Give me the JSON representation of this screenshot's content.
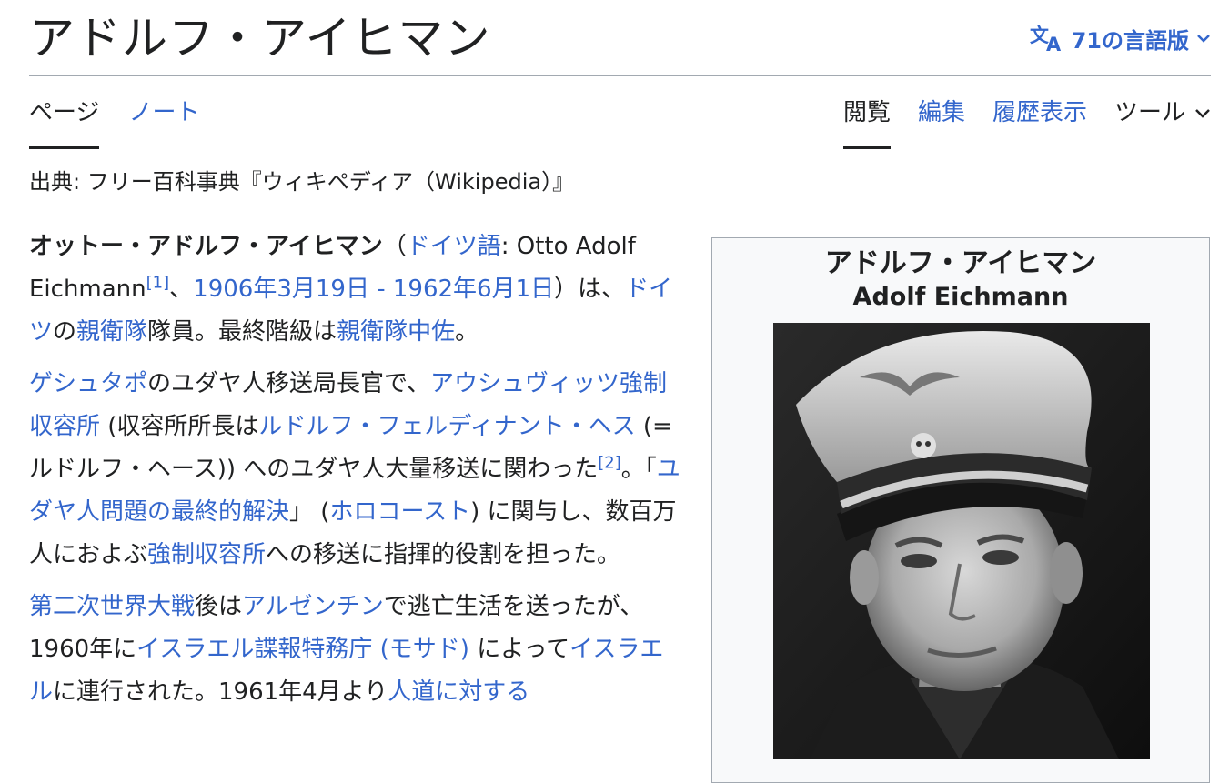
{
  "page": {
    "title": "アドルフ・アイヒマン",
    "languages_label": "71の言語版",
    "site_sub": "出典: フリー百科事典『ウィキペディア（Wikipedia）』"
  },
  "tabs": {
    "left": [
      {
        "label": "ページ",
        "selected": true
      },
      {
        "label": "ノート",
        "selected": false
      }
    ],
    "right": [
      {
        "label": "閲覧",
        "selected": true
      },
      {
        "label": "編集",
        "selected": false
      },
      {
        "label": "履歴表示",
        "selected": false
      },
      {
        "label": "ツール",
        "selected": false
      }
    ]
  },
  "article": {
    "p1": {
      "bold_name": "オットー・アドルフ・アイヒマン",
      "paren_open": "（",
      "lang_link": "ドイツ語",
      "lang_text": ": Otto Adolf Eichmann",
      "ref1": "[1]",
      "sep1": "、",
      "birth_link": "1906年3月19日",
      "dash": " - ",
      "death_link": "1962年6月1日",
      "after_dates": "）は、",
      "germany_link": "ドイツ",
      "no": "の",
      "ss_link": "親衛隊",
      "member": "隊員。最終階級は",
      "rank_link": "親衛隊中佐",
      "end": "。"
    },
    "p2": {
      "gestapo_link": "ゲシュタポ",
      "t1": "のユダヤ人移送局長官で、",
      "auschwitz_link": "アウシュヴィッツ強制収容所",
      "t2": " (収容所所長は",
      "hoss_link": "ルドルフ・フェルディナント・ヘス",
      "t3": " (=ルドルフ・ヘース)) へのユダヤ人大量移送に関わった",
      "ref2": "[2]",
      "t4": "。「",
      "final_solution_link": "ユダヤ人問題の最終的解決",
      "t5": "」 (",
      "holocaust_link": "ホロコースト",
      "t6": ") に関与し、数百万人におよぶ",
      "camp_link": "強制収容所",
      "t7": "への移送に指揮的役割を担った。"
    },
    "p3": {
      "ww2_link": "第二次世界大戦",
      "t1": "後は",
      "argentina_link": "アルゼンチン",
      "t2": "で逃亡生活を送ったが、1960年に",
      "mossad_link": "イスラエル諜報特務庁 (モサド)",
      "t3": " によって",
      "israel_link": "イスラエル",
      "t4": "に連行された。1961年4月より",
      "humanity_link": "人道に対する"
    }
  },
  "infobox": {
    "title": "アドルフ・アイヒマン",
    "subtitle": "Adolf Eichmann"
  },
  "colors": {
    "link": "#3366cc",
    "text": "#202122",
    "border": "#a2a9b1"
  },
  "icons": {
    "language": "translate-icon",
    "dropdown": "chevron-down-icon"
  }
}
